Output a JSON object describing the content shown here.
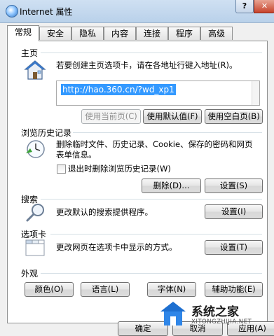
{
  "window": {
    "title": "Internet 属性",
    "help": "?",
    "close": "✕"
  },
  "tabs": [
    {
      "label": "常规"
    },
    {
      "label": "安全"
    },
    {
      "label": "隐私"
    },
    {
      "label": "内容"
    },
    {
      "label": "连接"
    },
    {
      "label": "程序"
    },
    {
      "label": "高级"
    }
  ],
  "homepage": {
    "title": "主页",
    "desc": "若要创建主页选项卡，请在各地址行键入地址(R)。",
    "url": "http://hao.360.cn/?wd_xp1",
    "buttons": {
      "current": "使用当前页(C)",
      "default": "使用默认值(F)",
      "blank": "使用空白页(B)"
    }
  },
  "history": {
    "title": "浏览历史记录",
    "desc_line1": "删除临时文件、历史记录、Cookie、保存的密码和网页",
    "desc_line2": "表单信息。",
    "checkbox_label": "退出时删除浏览历史记录(W)",
    "delete_button": "删除(D)...",
    "settings_button": "设置(S)"
  },
  "search": {
    "title": "搜索",
    "desc": "更改默认的搜索提供程序。",
    "settings_button": "设置(I)"
  },
  "tabs_section": {
    "title": "选项卡",
    "desc": "更改网页在选项卡中显示的方式。",
    "settings_button": "设置(T)"
  },
  "appearance": {
    "title": "外观",
    "buttons": {
      "colors": "颜色(O)",
      "languages": "语言(L)",
      "fonts": "字体(N)",
      "accessibility": "辅助功能(E)"
    }
  },
  "footer": {
    "ok": "确定",
    "cancel": "取消",
    "apply": "应用(A)"
  },
  "watermark": {
    "brand": "系统之家",
    "site": "XITONGZHIJIA.NET"
  }
}
